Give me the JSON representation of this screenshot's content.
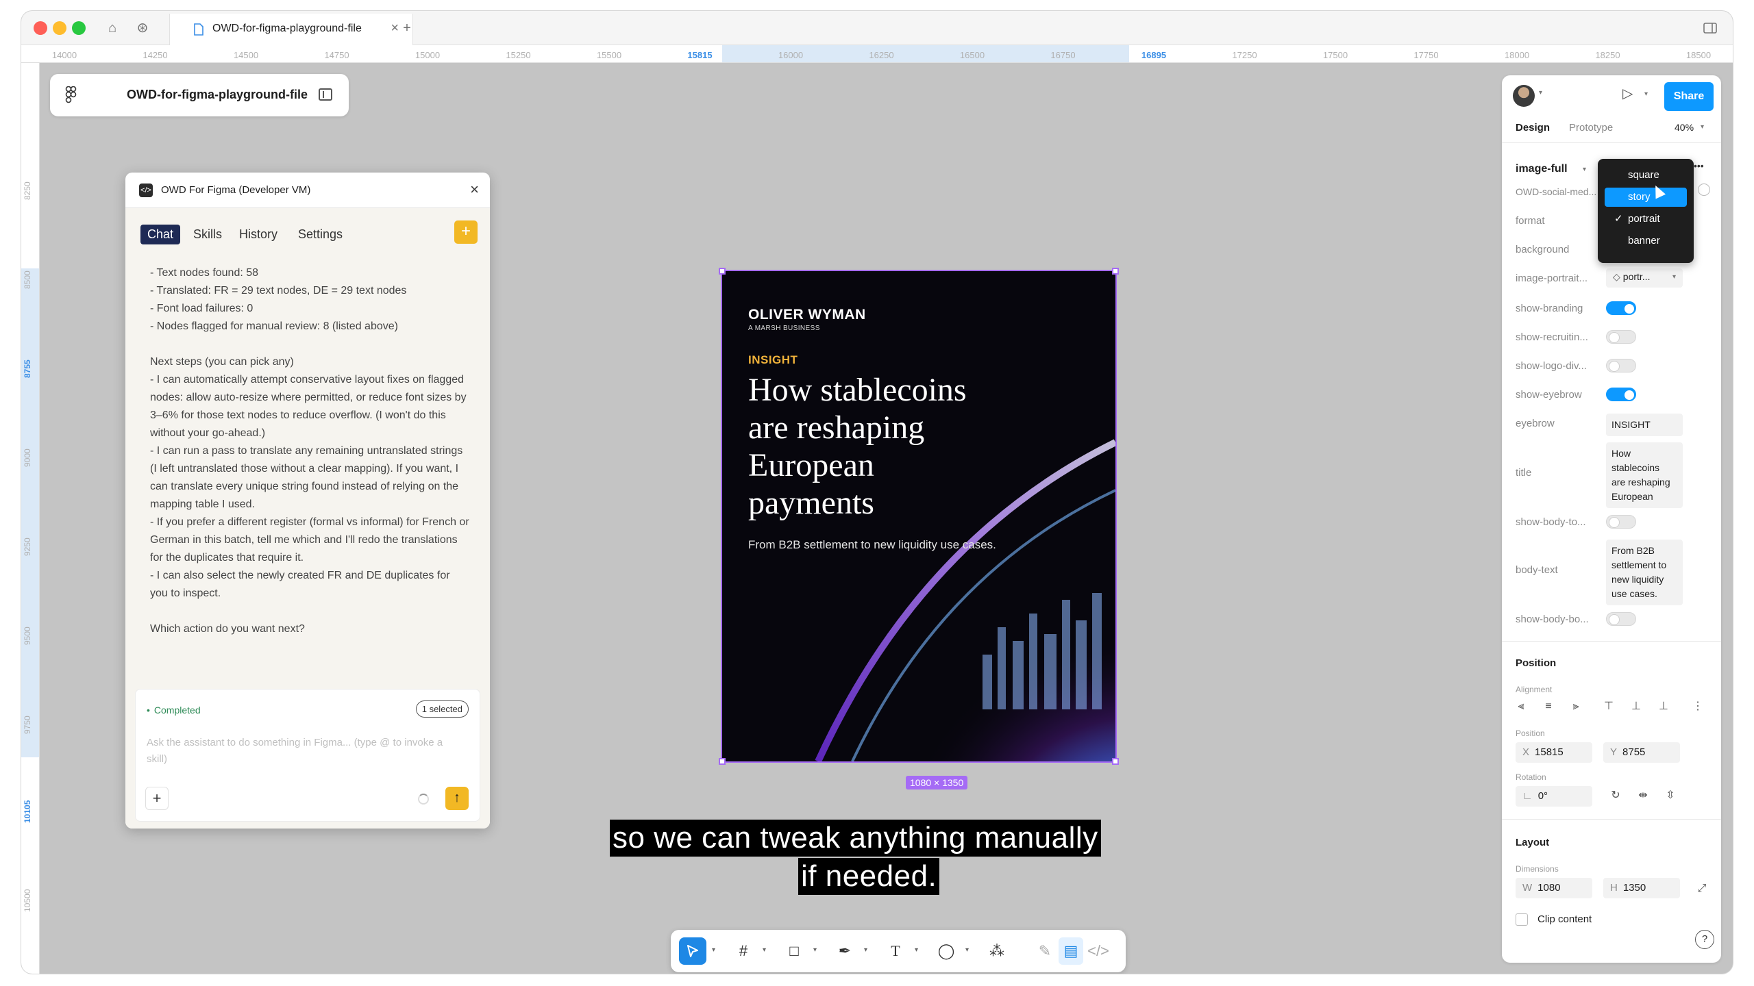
{
  "titlebar": {
    "tab_title": "OWD-for-figma-playground-file",
    "new_tab": "+",
    "close_tab": "×"
  },
  "ruler": {
    "ticks": [
      "14000",
      "14250",
      "14500",
      "14750",
      "15000",
      "15250",
      "15500",
      "15815",
      "16000",
      "16250",
      "16500",
      "16750",
      "16895",
      "17250",
      "17500",
      "17750",
      "18000",
      "18250",
      "18500"
    ],
    "vticks": [
      "8250",
      "8500",
      "8755",
      "9000",
      "9250",
      "9500",
      "9750",
      "10105",
      "10500"
    ]
  },
  "file_bar": {
    "file_name": "OWD-for-figma-playground-file"
  },
  "plugin": {
    "title": "OWD For Figma (Developer VM)",
    "tabs": [
      "Chat",
      "Skills",
      "History",
      "Settings"
    ],
    "plus": "+",
    "messages": [
      "- Text nodes found: 58",
      "- Translated: FR = 29 text nodes, DE = 29 text nodes",
      "- Font load failures: 0",
      "- Nodes flagged for manual review: 8 (listed above)",
      "",
      "Next steps (you can pick any)",
      "- I can automatically attempt conservative layout fixes on flagged nodes: allow auto-resize where permitted, or reduce font sizes by 3–6% for those text nodes to reduce overflow. (I won't do this without your go-ahead.)",
      "- I can run a pass to translate any remaining untranslated strings (I left untranslated those without a clear mapping). If you want, I can translate every unique string found instead of relying on the mapping table I used.",
      "- If you prefer a different register (formal vs informal) for French or German in this batch, tell me which and I'll redo the translations for the duplicates that require it.",
      "- I can also select the newly created FR and DE duplicates for you to inspect.",
      "",
      "Which action do you want next?"
    ],
    "composer": {
      "status": "Completed",
      "selection": "1 selected",
      "placeholder": "Ask the assistant to do something in Figma... (type @ to invoke a skill)",
      "add": "+",
      "send": "↑"
    }
  },
  "artboard": {
    "brand": "OLIVER WYMAN",
    "brand_sub": "A MARSH BUSINESS",
    "eyebrow": "INSIGHT",
    "title_lines": [
      "How stablecoins",
      "are reshaping",
      "European",
      "payments"
    ],
    "body": "From B2B settlement to new liquidity use cases.",
    "dimensions": "1080 × 1350"
  },
  "subtitles": [
    "so we can tweak anything manually",
    "if needed."
  ],
  "design_panel": {
    "share": "Share",
    "tabs": [
      "Design",
      "Prototype"
    ],
    "zoom": "40%",
    "component_name": "image-full",
    "component_sub": "OWD-social-med...",
    "more": "•••",
    "props": {
      "format": "format",
      "background": "background",
      "image_portrait": "image-portrait...",
      "image_portrait_value": "portr...",
      "show_branding": "show-branding",
      "show_recruiting": "show-recruitin...",
      "show_logo_div": "show-logo-div...",
      "show_eyebrow": "show-eyebrow",
      "eyebrow": "eyebrow",
      "eyebrow_value": "INSIGHT",
      "title": "title",
      "title_value_lines": [
        "How",
        "stablecoins",
        "are reshaping",
        "European"
      ],
      "show_body_to": "show-body-to...",
      "body_text": "body-text",
      "body_text_lines": [
        "From B2B",
        "settlement to",
        "new liquidity",
        "use cases."
      ],
      "show_body_bo": "show-body-bo..."
    },
    "toggles": {
      "show_branding": true,
      "show_recruiting": false,
      "show_logo_div": false,
      "show_eyebrow": true,
      "show_body_to": false,
      "show_body_bo": false
    },
    "position": {
      "section": "Position",
      "alignment": "Alignment",
      "position_label": "Position",
      "x_prefix": "X",
      "x": "15815",
      "y_prefix": "Y",
      "y": "8755",
      "rotation_label": "Rotation",
      "rotation": "0°"
    },
    "layout": {
      "section": "Layout",
      "dimensions_label": "Dimensions",
      "w_prefix": "W",
      "w": "1080",
      "h_prefix": "H",
      "h": "1350",
      "clip": "Clip content"
    },
    "help": "?"
  },
  "format_dropdown": {
    "options": [
      "square",
      "story",
      "portrait",
      "banner"
    ],
    "hovered": "story",
    "selected": "portrait"
  },
  "toolbar": {
    "tools": [
      "move-tool",
      "frame-tool",
      "shape-tool",
      "pen-tool",
      "text-tool",
      "comment-tool",
      "actions-tool",
      "draw-mode",
      "design-mode",
      "dev-mode"
    ]
  },
  "colors": {
    "accent_blue": "#0d99ff",
    "selection_purple": "#a56bf5",
    "plugin_yellow": "#f2b824",
    "eyebrow_gold": "#f0b23a",
    "chat_tab_navy": "#1e2a55"
  }
}
